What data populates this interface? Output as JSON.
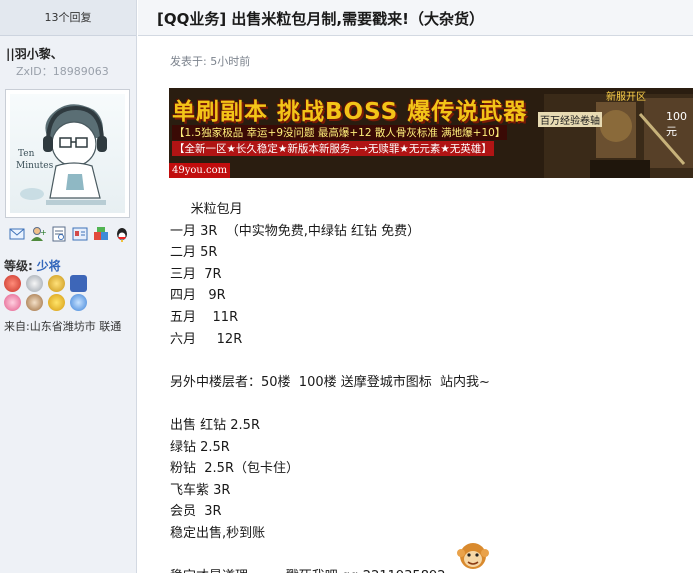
{
  "thread": {
    "reply_count": "13个回复",
    "title": "[QQ业务] 出售米粒包月制,需要戳来!（大杂货）"
  },
  "author": {
    "name": "||羽小黎、",
    "zxid": "ZxID：18989063",
    "avatar_caption": "Ten Minutes",
    "level_label": "等级:",
    "level_value": "少将",
    "location": "来自:山东省潍坊市 联通"
  },
  "post": {
    "posted": "发表于: 5小时前",
    "lines": [
      "     米粒包月",
      "一月 3R  （中实物免费,中绿钻 红钻 免费）",
      "二月 5R",
      "三月  7R",
      "四月   9R",
      "五月    11R",
      "六月     12R",
      "",
      "另外中楼层者：50楼  100楼 送摩登城市图标  站内我~",
      "",
      "出售 红钻 2.5R",
      "绿钻 2.5R",
      "粉钻  2.5R（包卡住）",
      "飞车紫 3R",
      "会员  3R",
      "稳定出售,秒到账",
      "",
      "稳定才是道理。      戳死我吧 qq:2211935892"
    ]
  },
  "banner": {
    "headline": "单刷副本 挑战BOSS 爆传说武器",
    "line1": "【1.5独家极品 幸运+9没问题 最高爆+12 散人骨灰标准 满地爆+10】",
    "line2": "【全新一区★长久稳定★新版本新服务→→无赎罪★无元素★无英雄】",
    "url": "49you.com",
    "scroll_label": "百万经验卷轴",
    "tag": "新服开区",
    "number": "100元"
  },
  "icons": [
    "message-icon",
    "add-friend-icon",
    "profile-icon",
    "card-icon",
    "gift-icon",
    "qq-icon"
  ],
  "colors": {
    "accent": "#3266bb",
    "sidebar_bg": "#eef1f6",
    "banner_red": "#c10d0d"
  }
}
